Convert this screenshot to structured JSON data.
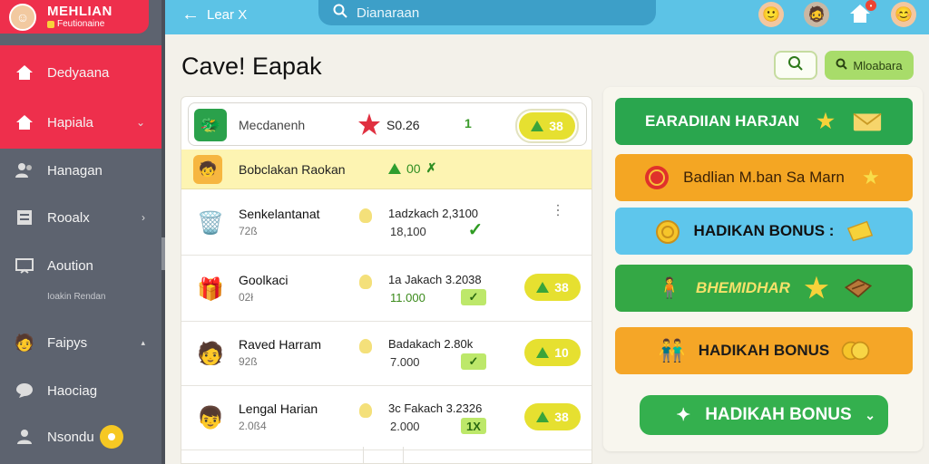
{
  "sidebar": {
    "brand_title": "MEHLIAN",
    "brand_subtitle": "Feutionaine",
    "items": [
      {
        "label": "Dedyaana",
        "icon": "home-icon"
      },
      {
        "label": "Hapiala",
        "icon": "home-icon"
      },
      {
        "label": "Hanagan",
        "icon": "users-icon"
      },
      {
        "label": "Rooalx",
        "icon": "document-icon"
      },
      {
        "label": "Aoution",
        "icon": "presentation-icon"
      },
      {
        "label": "Faipys",
        "icon": "avatar-icon"
      },
      {
        "label": "Haociag",
        "icon": "chat-icon"
      },
      {
        "label": "Nsondu",
        "icon": "user-icon"
      }
    ],
    "sub_label": "Ioakin Rendan"
  },
  "topbar": {
    "back_label": "Lear X",
    "search_text": "Dianaraan"
  },
  "main": {
    "title": "Cave! Eapak",
    "filter_button_label": "Mloabara"
  },
  "list": {
    "top": {
      "name": "Mecdanenh",
      "value": "S0.26",
      "mark": "1",
      "pill": "38"
    },
    "highlight": {
      "name": "Bobclakan Raokan",
      "amount": "00"
    },
    "rows": [
      {
        "name": "Senkelantanat",
        "sub": "72ß",
        "date": "1adzkach 2,3100",
        "num": "18,100",
        "check": "✓"
      },
      {
        "name": "Goolkaci",
        "sub": "02ł",
        "date": "1a Jakach 3.2038",
        "num": "11.000",
        "check": "✓",
        "pill": "38"
      },
      {
        "name": "Raved Harram",
        "sub": "92ß",
        "date": "Badakach 2.80k",
        "num": "7.000",
        "check": "✓",
        "pill": "10"
      },
      {
        "name": "Lengal Harian",
        "sub": "2.0ß4",
        "date": "3c Fakach 3.2326",
        "num": "2.000",
        "check": "1X",
        "pill": "38"
      }
    ]
  },
  "panel": {
    "cards": [
      {
        "label": "EARADIIAN HARJAN"
      },
      {
        "label": "Badlian M.ban Sa Marn"
      },
      {
        "label": "HADIKAN BONUS :"
      },
      {
        "label": "BHEMIDHAR"
      },
      {
        "label": "HADIKAH BONUS"
      }
    ],
    "button_label": "HADIKAH BONUS"
  },
  "colors": {
    "sidebar_red": "#ee2f4c",
    "topbar_blue": "#5cc3e6",
    "green": "#2aa64e",
    "orange": "#f4a623",
    "sky": "#5ec6ec"
  }
}
